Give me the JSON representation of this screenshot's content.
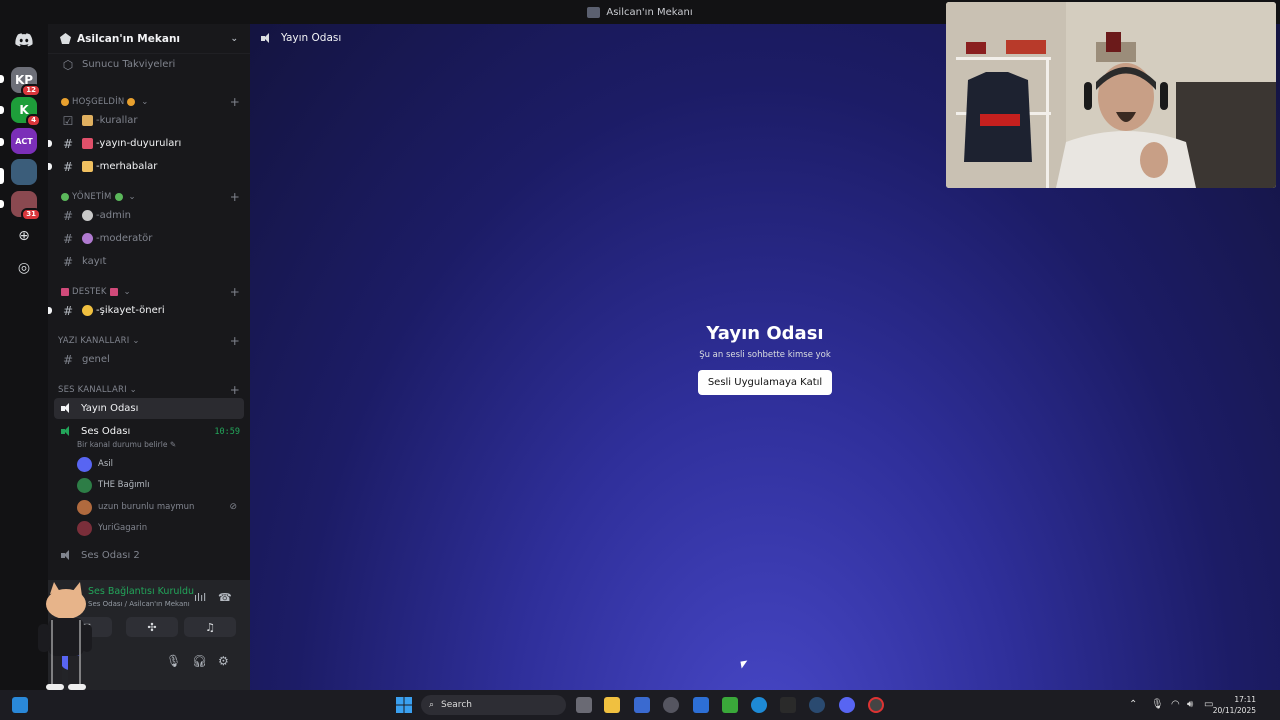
{
  "window": {
    "title": "Asilcan'ın Mekanı"
  },
  "rail": {
    "servers": [
      {
        "name": "server-kp",
        "label": "KP",
        "color": "#6d6f78",
        "badge": "12"
      },
      {
        "name": "server-kick",
        "label": "K",
        "color": "#1e9e3a",
        "badge": "4"
      },
      {
        "name": "server-act",
        "label": "ACT",
        "color": "#7b2fb8",
        "badge": ""
      },
      {
        "name": "server-car",
        "label": "",
        "color": "#3b5d7a",
        "badge": ""
      },
      {
        "name": "server-anime",
        "label": "",
        "color": "#8a4950",
        "badge": "31"
      }
    ]
  },
  "sidebar": {
    "server_name": "Asilcan'ın Mekanı",
    "boosts": "Sunucu Takviyeleri",
    "categories": {
      "hosgeldin": "HOŞGELDİN",
      "yonetim": "YÖNETİM",
      "destek": "DESTEK",
      "yazi": "YAZI KANALLARI",
      "ses": "SES KANALLARI"
    },
    "channels": {
      "kurallar": "-kurallar",
      "yayin_duyurulari": "-yayın-duyuruları",
      "merhabalar": "-merhabalar",
      "admin": "-admin",
      "moderator": "-moderatör",
      "kayit": "kayıt",
      "sikayet": "-şikayet-öneri",
      "genel": "genel",
      "yayin_odasi": "Yayın Odası",
      "ses_odasi": "Ses Odası",
      "ses_odasi_2": "Ses Odası 2"
    },
    "ses_odasi_timer": "10:59",
    "ses_odasi_status": "Bir kanal durumu belirle",
    "members": [
      {
        "name": "Asil",
        "color": "#5865f2",
        "muted": false
      },
      {
        "name": "THE Bağımlı",
        "color": "#2d7d46",
        "muted": false
      },
      {
        "name": "uzun burunlu maymun",
        "color": "#b06a3e",
        "muted": true
      },
      {
        "name": "YuriGagarin",
        "color": "#7a2e3a",
        "muted": false
      }
    ]
  },
  "voice_panel": {
    "status": "Ses Bağlantısı Kuruldu",
    "location": "Ses Odası / Asilcan'ın Mekanı"
  },
  "main": {
    "channel_title": "Yayın Odası",
    "empty_title": "Yayın Odası",
    "empty_subtitle": "Şu an sesli sohbette kimse yok",
    "join_button": "Sesli Uygulamaya Katıl"
  },
  "taskbar": {
    "search_placeholder": "Search",
    "time": "17:11",
    "date": "20/11/2025"
  }
}
